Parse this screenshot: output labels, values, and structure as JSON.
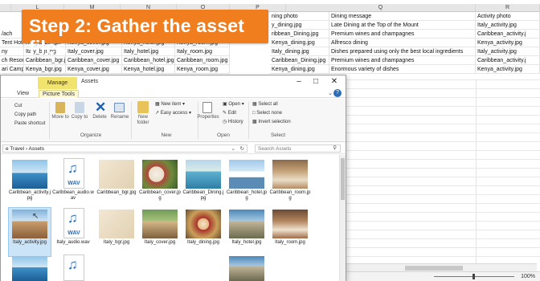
{
  "banner": {
    "text": "Step 2: Gather the asset files"
  },
  "sheet": {
    "columns": [
      "L",
      "M",
      "N",
      "O",
      "P",
      "Q",
      "R"
    ],
    "headers": {
      "P": "ning photo",
      "Q": "Dining message",
      "R": "Activity photo"
    },
    "rows": [
      {
        "K": "",
        "L": "",
        "M": "",
        "N": "",
        "O": "",
        "P": "y_dining.jpg",
        "Q": "Late Dining at the Top of the Mount",
        "R": "Italy_activity.jpg"
      },
      {
        "K": "/ach",
        "L": "",
        "M": "",
        "N": "",
        "O": "",
        "P": "ribbean_Dining.jpg",
        "Q": "Premium wines and champagnes",
        "R": "Caribbean_activity.j"
      },
      {
        "K": "Tent Hotel",
        "L": "Kenya_bgr.jpg",
        "M": "Kenya_cover.jpg",
        "N": "Kenya_hotel.jpg",
        "O": "Kenya_room.jpg",
        "P": "Kenya_dining.jpg",
        "Q": "Alfresco dining",
        "R": "Kenya_activity.jpg"
      },
      {
        "K": "ny",
        "L": "Italy_bgr.jpg",
        "M": "Italy_cover.jpg",
        "N": "Italy_hotel.jpg",
        "O": "Italy_room.jpg",
        "P": "Italy_dining.jpg",
        "Q": "Dishes prepared using only the best local ingredients",
        "R": "Italy_activity.jpg"
      },
      {
        "K": "ch Resort",
        "L": "Caribbean_bgr.jpg",
        "M": "Caribbean_cover.jpg",
        "N": "Caribbean_hotel.jpg",
        "O": "Caribbean_room.jpg",
        "P": "Caribbean_Dining.jpg",
        "Q": "Premium wines and champagnes",
        "R": "Caribbean_activity.j"
      },
      {
        "K": "ari Camp",
        "L": "Kenya_bgr.jpg",
        "M": "Kenya_cover.jpg",
        "N": "Kenya_hotel.jpg",
        "O": "Kenya_room.jpg",
        "P": "Kenya_dining.jpg",
        "Q": "Enormous variety of dishes",
        "R": "Kenya_activity.jpg"
      }
    ],
    "zoom": "100%"
  },
  "explorer": {
    "manage_tab": "Manage",
    "title": "Assets",
    "tabs": [
      "View",
      "Picture Tools"
    ],
    "ribbon": {
      "clipboard": {
        "cut": "Cut",
        "copy_path": "Copy path",
        "paste_shortcut": "Paste shortcut"
      },
      "organize": {
        "move_to": "Move to",
        "copy_to": "Copy to",
        "delete": "Delete",
        "rename": "Rename",
        "group": "Organize"
      },
      "new": {
        "new_item": "New item",
        "easy_access": "Easy access",
        "new_folder": "New folder",
        "group": "New"
      },
      "open": {
        "properties": "Properties",
        "open": "Open",
        "edit": "Edit",
        "history": "History",
        "group": "Open"
      },
      "select": {
        "select_all": "Select all",
        "select_none": "Select none",
        "invert": "Invert selection",
        "group": "Select"
      }
    },
    "address": "e Travel  ›  Assets",
    "search_placeholder": "Search Assets",
    "files_row1": [
      {
        "name": "Caribbean_activity.jpg",
        "kind": "sea"
      },
      {
        "name": "Caribbean_audio.wav",
        "kind": "wav"
      },
      {
        "name": "Caribbean_bgr.jpg",
        "kind": "tan"
      },
      {
        "name": "Caribbean_cover.jpg",
        "kind": "food"
      },
      {
        "name": "Caribbean_Dining.jpg",
        "kind": "pool"
      },
      {
        "name": "Caribbean_hotel.jpg",
        "kind": "ship"
      },
      {
        "name": "Caribbean_room.jpg",
        "kind": "room"
      }
    ],
    "files_row2": [
      {
        "name": "Italy_activity.jpg",
        "kind": "italy"
      },
      {
        "name": "Italy_audio.wav",
        "kind": "wav"
      },
      {
        "name": "Italy_bgr.jpg",
        "kind": "tan"
      },
      {
        "name": "Italy_cover.jpg",
        "kind": "cover"
      },
      {
        "name": "Italy_dining.jpg",
        "kind": "dine"
      },
      {
        "name": "Italy_hotel.jpg",
        "kind": "hotel"
      },
      {
        "name": "Italy_room.jpg",
        "kind": "room2"
      }
    ],
    "wav_label": "WAV",
    "selected_file": "Italy_activity.jpg"
  }
}
